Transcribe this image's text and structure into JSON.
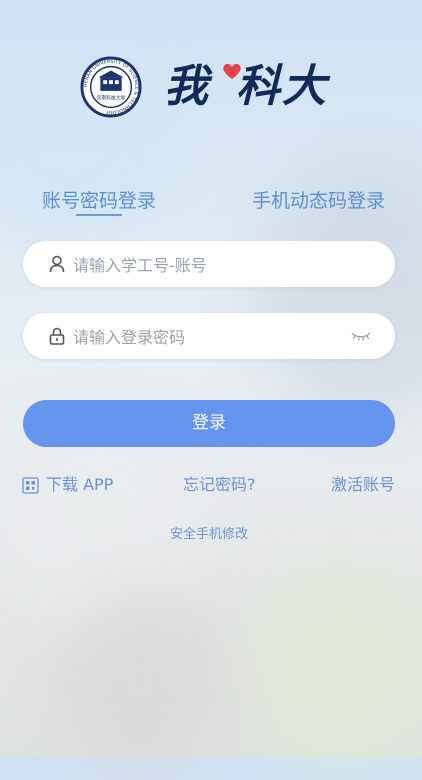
{
  "brand": {
    "emblem_ring_text": "HENAN UNIVERSITY OF SCIENCE & TECHNOLOGY",
    "emblem_inner_text": "河南科技大学",
    "logo_text_left": "我",
    "logo_text_right": "科大"
  },
  "tabs": {
    "account": "账号密码登录",
    "phone": "手机动态码登录"
  },
  "form": {
    "username_placeholder": "请输入学工号-账号",
    "password_placeholder": "请输入登录密码",
    "submit_label": "登录"
  },
  "links": {
    "download_app": "下载 APP",
    "forgot_password": "忘记密码?",
    "activate_account": "激活账号",
    "change_phone": "安全手机修改"
  },
  "colors": {
    "accent": "#6595ee",
    "link": "#6a93d6",
    "logo_navy": "#102a5c",
    "heart": "#e8414b"
  },
  "icons": {
    "user": "user-icon",
    "lock": "lock-icon",
    "eye": "eye-closed-icon",
    "qr": "qr-code-icon",
    "heart": "heart-icon",
    "emblem": "university-emblem-icon"
  }
}
